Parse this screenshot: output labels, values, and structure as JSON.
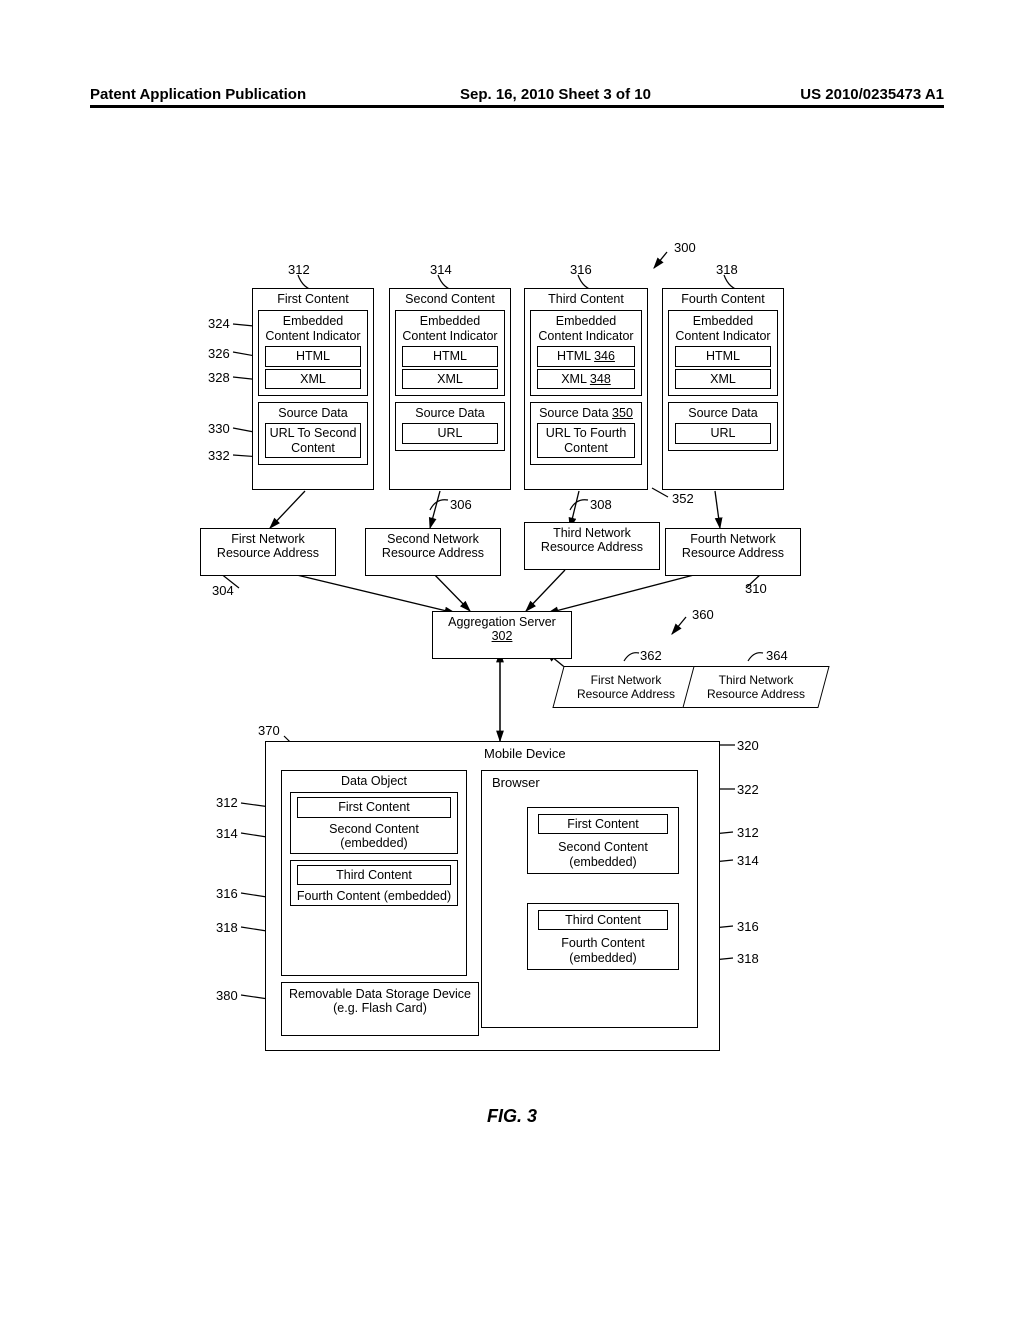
{
  "header": {
    "left": "Patent Application Publication",
    "mid": "Sep. 16, 2010  Sheet 3 of 10",
    "right": "US 2010/0235473 A1"
  },
  "figLabel": "FIG. 3",
  "refs": {
    "r300": "300",
    "r312": "312",
    "r314": "314",
    "r316": "316",
    "r318": "318",
    "r324": "324",
    "r326": "326",
    "r328": "328",
    "r330": "330",
    "r332": "332",
    "r304": "304",
    "r306": "306",
    "r308": "308",
    "r310": "310",
    "r352": "352",
    "r302": "302",
    "r360": "360",
    "r362": "362",
    "r364": "364",
    "r370": "370",
    "r320": "320",
    "r322": "322",
    "r380": "380",
    "rl312": "312",
    "rl314": "314",
    "rl316": "316",
    "rl318": "318",
    "rr312": "312",
    "rr314": "314",
    "rr316": "316",
    "rr318": "318"
  },
  "contentBoxes": {
    "c1": {
      "title": "First Content",
      "eci": "Embedded Content Indicator",
      "html": "HTML",
      "xml": "XML",
      "src": "Source Data",
      "url": "URL To Second Content"
    },
    "c2": {
      "title": "Second Content",
      "eci": "Embedded Content Indicator",
      "html": "HTML",
      "xml": "XML",
      "src": "Source Data",
      "url": "URL"
    },
    "c3": {
      "title": "Third Content",
      "eci": "Embedded Content Indicator",
      "html": "HTML 346",
      "xml": "XML 348",
      "src": "Source Data 350",
      "url": "URL To Fourth Content"
    },
    "c4": {
      "title": "Fourth Content",
      "eci": "Embedded Content Indicator",
      "html": "HTML",
      "xml": "XML",
      "src": "Source Data",
      "url": "URL"
    }
  },
  "nra": {
    "n1": "First Network Resource Address",
    "n2": "Second Network Resource Address",
    "n3": "Third Network Resource Address",
    "n4": "Fourth Network Resource Address"
  },
  "agg": {
    "label": "Aggregation Server",
    "num": "302"
  },
  "para": {
    "p1": "First Network Resource Address",
    "p2": "Third Network Resource Address"
  },
  "mobile": {
    "title": "Mobile Device",
    "dataObject": "Data Object",
    "fc": "First Content",
    "sc": "Second Content (embedded)",
    "tc": "Third Content",
    "foc": "Fourth Content (embedded)",
    "storage": "Removable Data Storage Device (e.g. Flash Card)",
    "browser": "Browser"
  }
}
